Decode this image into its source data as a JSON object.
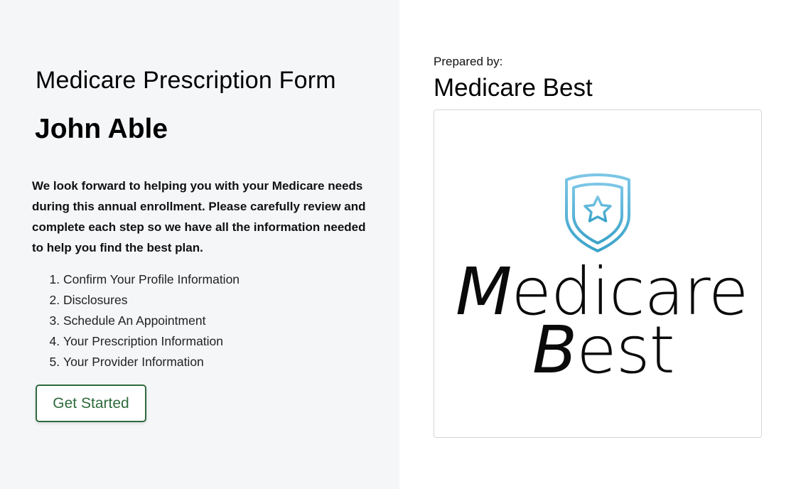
{
  "form": {
    "title": "Medicare Prescription Form",
    "client_name": "John Able",
    "intro": "We look forward to helping you with your Medicare needs during this annual enrollment. Please carefully review and complete each step so we have all the information needed to help you find the best plan.",
    "steps": [
      "Confirm Your Profile Information",
      "Disclosures",
      "Schedule An Appointment",
      "Your Prescription Information",
      "Your Provider Information"
    ],
    "button_label": "Get Started"
  },
  "preparer": {
    "label": "Prepared by:",
    "company": "Medicare Best",
    "logo": {
      "icon": "shield-star-icon",
      "line1_initial": "M",
      "line1_rest": "edicare",
      "line2_initial": "B",
      "line2_rest": "est"
    }
  },
  "colors": {
    "left_background": "#f5f6f8",
    "button_accent": "#2f6b3d",
    "shield_gradient_top": "#7cc6e6",
    "shield_gradient_bottom": "#3aa3c9"
  }
}
